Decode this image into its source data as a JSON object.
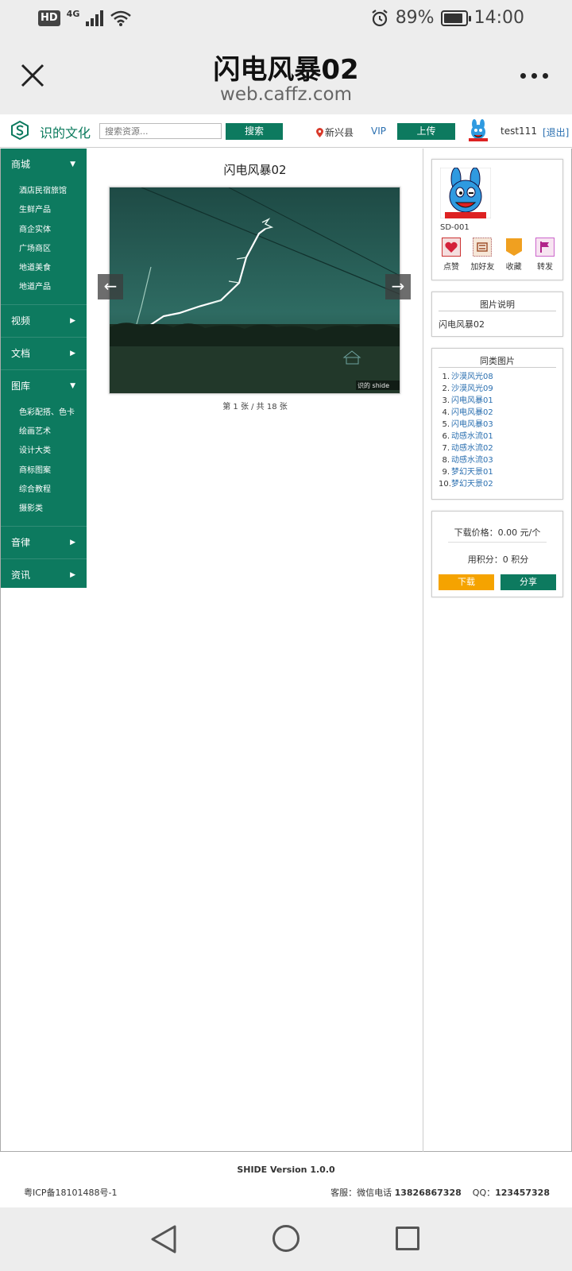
{
  "status_bar": {
    "hd": "HD",
    "network": "4G",
    "battery_text": "89%",
    "battery_level": 0.89,
    "time": "14:00"
  },
  "header": {
    "title": "闪电风暴02",
    "url": "web.caffz.com"
  },
  "site_nav": {
    "brand": "识的文化",
    "search_placeholder": "搜索资源...",
    "search_button": "搜索",
    "location": "新兴县",
    "vip": "VIP",
    "upload": "上传",
    "username": "test111",
    "logout": "[退出]"
  },
  "left_menu": {
    "shop": "商城",
    "shop_items": [
      "酒店民宿旅馆",
      "生鲜产品",
      "商企实体",
      "广场商区",
      "地道美食",
      "地道产品"
    ],
    "video": "视频",
    "docs": "文档",
    "gallery": "图库",
    "gallery_items": [
      "色彩配搭、色卡",
      "绘画艺术",
      "设计大类",
      "商标图案",
      "综合教程",
      "摄影类"
    ],
    "music": "音律",
    "news": "资讯"
  },
  "viewer": {
    "title": "闪电风暴02",
    "watermark": "识的 shide",
    "prev_arrow": "←",
    "next_arrow": "→",
    "pager": "第 1 张 / 共 18 张"
  },
  "user_panel": {
    "code": "SD-001",
    "actions": [
      "点赞",
      "加好友",
      "收藏",
      "转发"
    ]
  },
  "description_panel": {
    "heading": "图片说明",
    "text": "闪电风暴02"
  },
  "similar_panel": {
    "heading": "同类图片",
    "items": [
      {
        "n": "1.",
        "t": "沙漠风光08"
      },
      {
        "n": "2.",
        "t": "沙漠风光09"
      },
      {
        "n": "3.",
        "t": "闪电风暴01"
      },
      {
        "n": "4.",
        "t": "闪电风暴02"
      },
      {
        "n": "5.",
        "t": "闪电风暴03"
      },
      {
        "n": "6.",
        "t": "动感水流01"
      },
      {
        "n": "7.",
        "t": "动感水流02"
      },
      {
        "n": "8.",
        "t": "动感水流03"
      },
      {
        "n": "9.",
        "t": "梦幻天景01"
      },
      {
        "n": "10.",
        "t": "梦幻天景02"
      }
    ]
  },
  "download_panel": {
    "price": "下载价格：0.00 元/个",
    "points": "用积分：0 积分",
    "download": "下载",
    "share": "分享"
  },
  "footer": {
    "version": "SHIDE Version 1.0.0",
    "icp": "粤ICP备18101488号-1",
    "service_label": "客服：微信电话 ",
    "phone": "13826867328",
    "qq_label": "QQ：",
    "qq": "123457328"
  },
  "colors": {
    "brand_green": "#0d7a5f",
    "link_blue": "#2a6fb0",
    "download_orange": "#f5a300"
  }
}
